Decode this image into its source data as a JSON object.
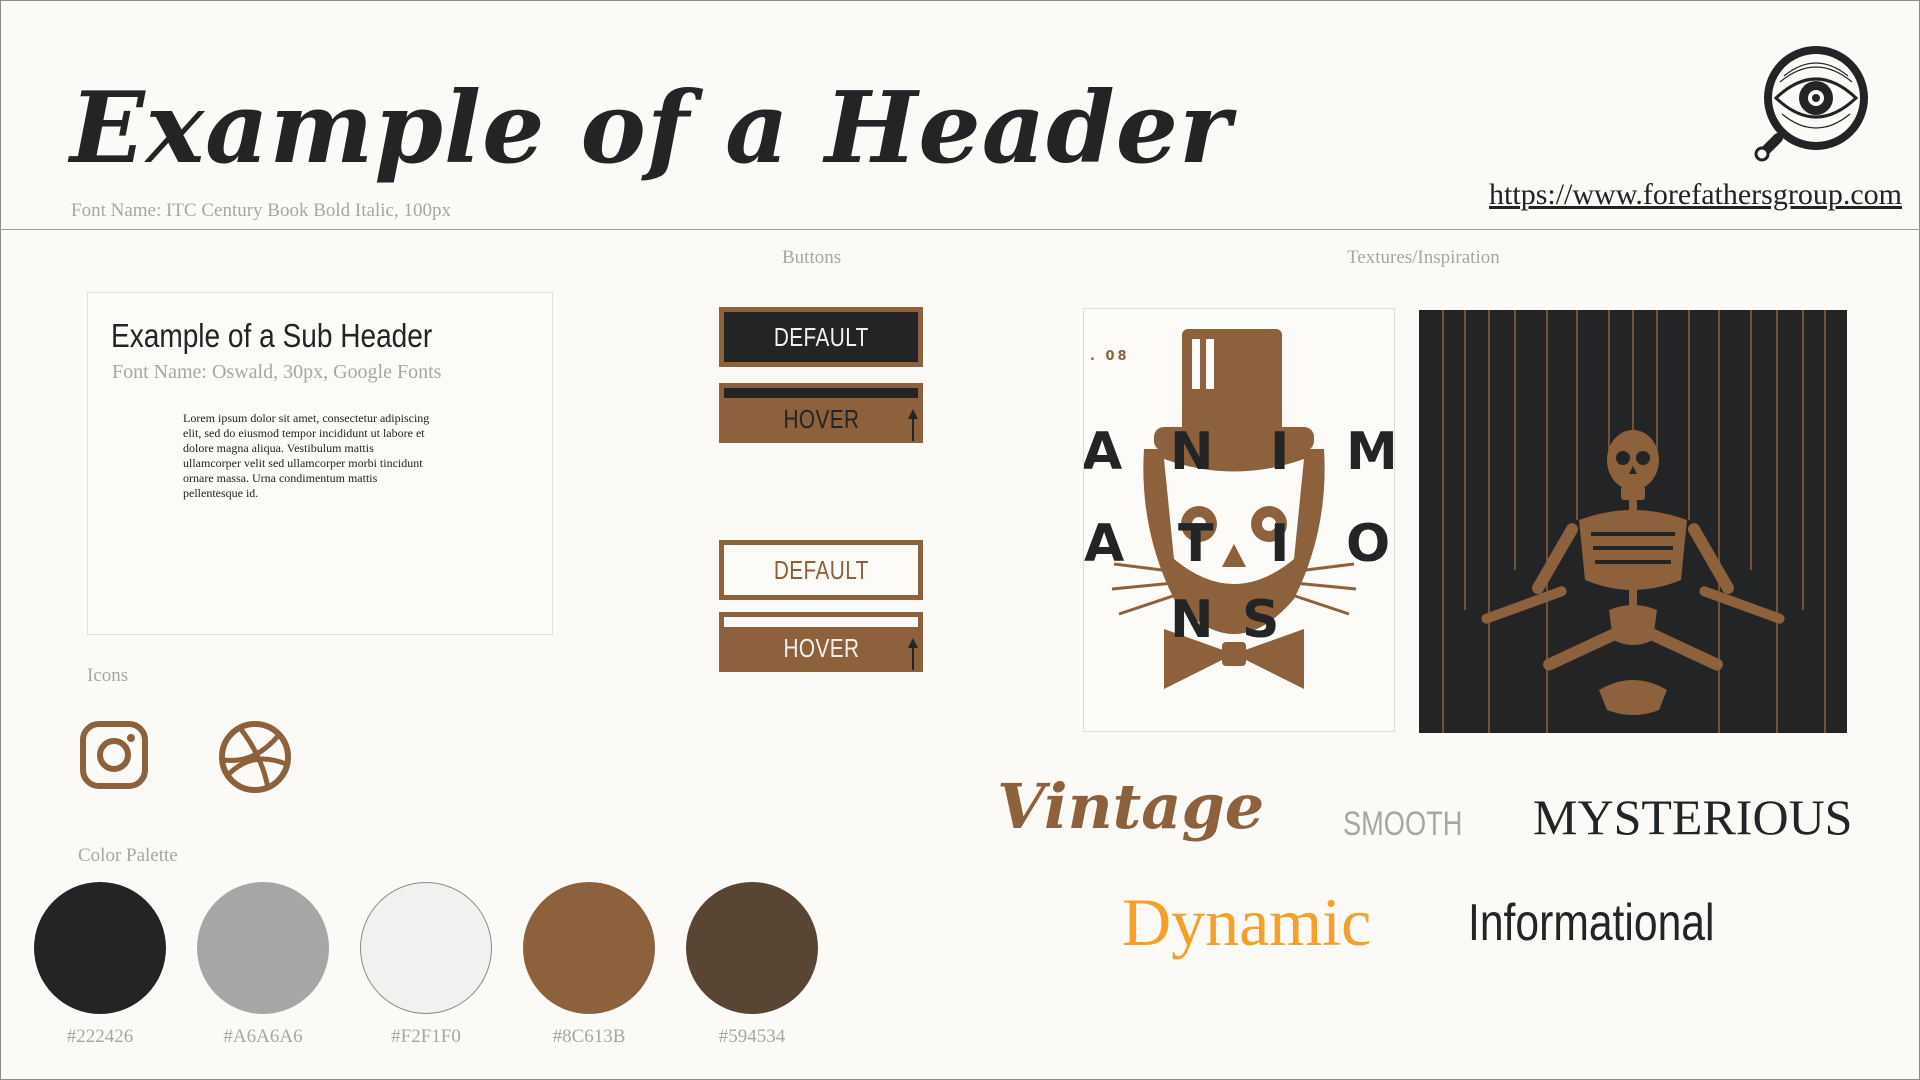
{
  "header": {
    "title": "Example of a Header",
    "font_caption": "Font Name: ITC Century Book Bold Italic, 100px",
    "url": "https://www.forefathersgroup.com",
    "logo_icon": "eye-magnifier-icon"
  },
  "sub_header_card": {
    "title": "Example of a Sub Header",
    "font_caption": "Font Name: Oswald, 30px, Google Fonts",
    "body": "Lorem ipsum dolor sit amet, consectetur adipiscing elit, sed do eiusmod tempor incididunt ut labore et dolore magna aliqua. Vestibulum mattis ullamcorper velit sed ullamcorper morbi tincidunt ornare massa. Urna condimentum mattis pellentesque id."
  },
  "buttons": {
    "section_label": "Buttons",
    "dark_default": "DEFAULT",
    "dark_hover": "HOVER",
    "light_default": "DEFAULT",
    "light_hover": "HOVER"
  },
  "icons": {
    "section_label": "Icons",
    "items": [
      "instagram-icon",
      "dribbble-icon"
    ]
  },
  "textures": {
    "section_label": "Textures/Inspiration",
    "poster_number": ". 08",
    "poster_letters": [
      "A",
      "N",
      "I",
      "M",
      "A",
      "T",
      "I",
      "O",
      "N",
      "S"
    ]
  },
  "moods": {
    "vintage": "Vintage",
    "smooth": "SMOOTH",
    "mysterious": "MYSTERIOUS",
    "dynamic": "Dynamic",
    "informational": "Informational"
  },
  "palette": {
    "section_label": "Color Palette",
    "colors": [
      {
        "hex": "#222426",
        "label": "#222426"
      },
      {
        "hex": "#A6A6A6",
        "label": "#A6A6A6"
      },
      {
        "hex": "#F2F1F0",
        "label": "#F2F1F0"
      },
      {
        "hex": "#8C613B",
        "label": "#8C613B"
      },
      {
        "hex": "#594534",
        "label": "#594534"
      }
    ]
  },
  "brand_colors": {
    "dark": "#222426",
    "gray": "#A6A6A6",
    "light": "#F2F1F0",
    "brown": "#8C613B",
    "dark_brown": "#594534",
    "accent_orange": "#F5A02A"
  }
}
